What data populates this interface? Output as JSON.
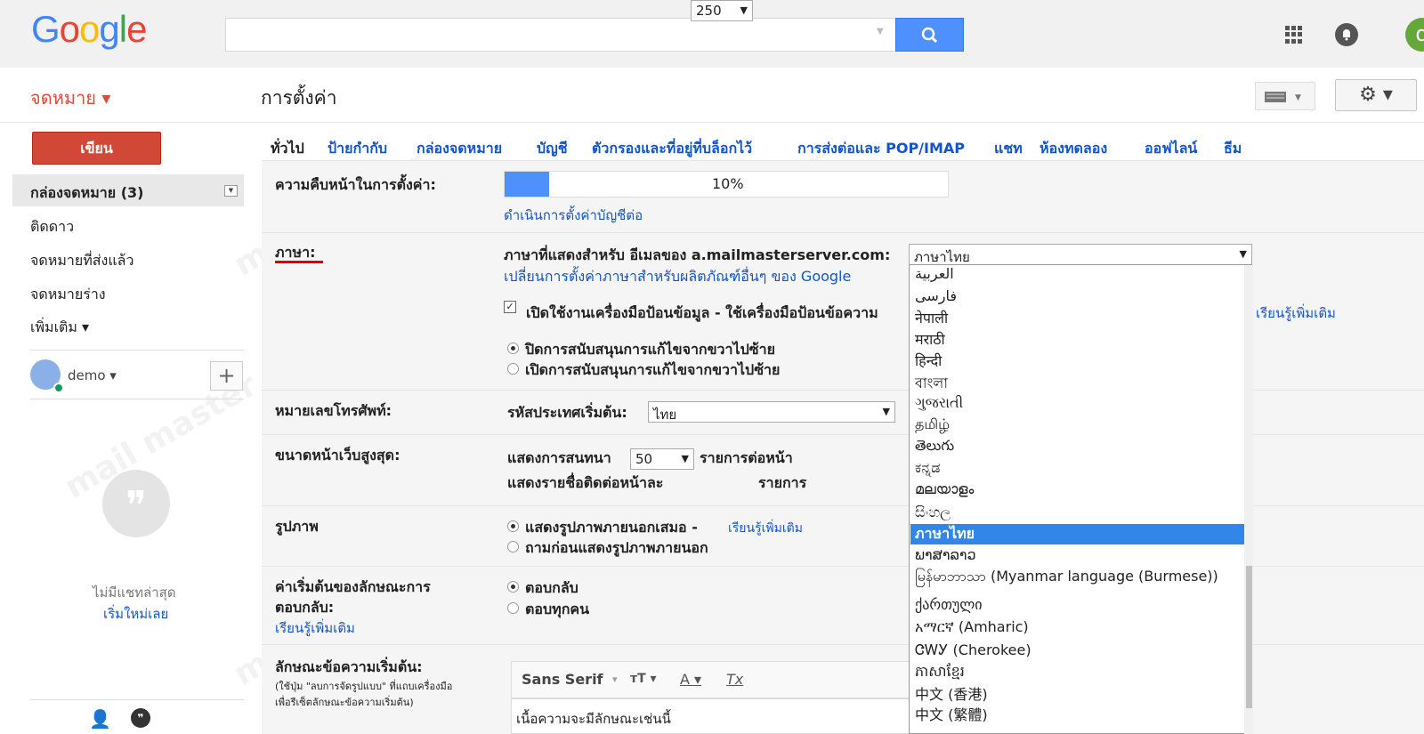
{
  "header": {
    "logo_letters": [
      {
        "ch": "G",
        "color": "#4285f4"
      },
      {
        "ch": "o",
        "color": "#ea4335"
      },
      {
        "ch": "o",
        "color": "#fbbc05"
      },
      {
        "ch": "g",
        "color": "#4285f4"
      },
      {
        "ch": "l",
        "color": "#34a853"
      },
      {
        "ch": "e",
        "color": "#ea4335"
      }
    ],
    "search_icon": "search-icon",
    "apps_icon": "apps-grid-icon",
    "notifications_icon": "notifications-icon",
    "avatar_letter": "d"
  },
  "subbar": {
    "mail_menu": "จดหมาย ▾",
    "page_title": "การตั้งค่า",
    "settings_icon": "⚙ ▾"
  },
  "sidebar": {
    "compose": "เขียน",
    "items": [
      {
        "label": "กล่องจดหมาย (3)"
      },
      {
        "label": "ติดดาว"
      },
      {
        "label": "จดหมายที่ส่งแล้ว"
      },
      {
        "label": "จดหมายร่าง"
      },
      {
        "label": "เพิ่มเติม ▾"
      }
    ],
    "user_name": "demo ▾",
    "add_chat": "+",
    "no_chats": "ไม่มีแชทล่าสุด",
    "start_new": "เริ่มใหม่เลย"
  },
  "tabs": [
    "ทั่วไป",
    "ป้ายกำกับ",
    "กล่องจดหมาย",
    "บัญชี",
    "ตัวกรองและที่อยู่ที่บล็อกไว้",
    "การส่งต่อและ POP/IMAP",
    "แชท",
    "ห้องทดลอง",
    "ออฟไลน์",
    "ธีม"
  ],
  "settings": {
    "progress": {
      "label": "ความคืบหน้าในการตั้งค่า:",
      "percent": 10,
      "percent_text": "10%",
      "continue_link": "ดำเนินการตั้งค่าบัญชีต่อ"
    },
    "language": {
      "label": "ภาษา:",
      "display_label": "ภาษาที่แสดงสำหรับ อีเมลของ a.mailmasterserver.com:",
      "selected": "ภาษาไทย",
      "change_link": "เปลี่ยนการตั้งค่าภาษาสำหรับผลิตภัณฑ์อื่นๆ ของ Google",
      "input_tools": "เปิดใช้งานเครื่องมือป้อนข้อมูล - ใช้เครื่องมือป้อนข้อความ",
      "learn_more": "เรียนรู้เพิ่มเติม",
      "rtl_off": "ปิดการสนับสนุนการแก้ไขจากขวาไปซ้าย",
      "rtl_on": "เปิดการสนับสนุนการแก้ไขจากขวาไปซ้าย",
      "options": [
        "العربية",
        "فارسی",
        "नेपाली",
        "मराठी",
        "हिन्दी",
        "বাংলা",
        "ગુજરાતી",
        "தமிழ்",
        "తెలుగు",
        "ಕನ್ನಡ",
        "മലയാളം",
        "සිංහල",
        "ภาษาไทย",
        "ພາສາລາວ",
        "မြန်မာဘာသာ (Myanmar language (Burmese))",
        "ქართული",
        "አማርኛ (Amharic)",
        "ᏣᎳᎩ (Cherokee)",
        "ភាសាខ្មែរ",
        "中文 (香港)",
        "中文 (繁體)"
      ]
    },
    "phone": {
      "label": "หมายเลขโทรศัพท์:",
      "country_label": "รหัสประเทศเริ่มต้น:",
      "country_value": "ไทย"
    },
    "page_size": {
      "label": "ขนาดหน้าเว็บสูงสุด:",
      "conv_prefix": "แสดงการสนทนา",
      "conv_value": "50",
      "conv_suffix": "รายการต่อหน้า",
      "contacts_prefix": "แสดงรายชื่อติดต่อหน้าละ",
      "contacts_value": "250",
      "contacts_suffix": "รายการ"
    },
    "images": {
      "label": "รูปภาพ",
      "always": "แสดงรูปภาพภายนอกเสมอ -",
      "learn_more": "เรียนรู้เพิ่มเติม",
      "ask": "ถามก่อนแสดงรูปภาพภายนอก"
    },
    "reply": {
      "label_line1": "ค่าเริ่มต้นของลักษณะการ",
      "label_line2": "ตอบกลับ:",
      "learn_more": "เรียนรู้เพิ่มเติม",
      "reply": "ตอบกลับ",
      "reply_all": "ตอบทุกคน"
    },
    "text_style": {
      "label": "ลักษณะข้อความเริ่มต้น:",
      "hint_line1": "(ใช้ปุ่ม \"ลบการจัดรูปแบบ\" ที่แถบเครื่องมือ",
      "hint_line2": "เพื่อรีเซ็ตลักษณะข้อความเริ่มต้น)",
      "font": "Sans Serif",
      "size_icon": "ᴛT ▾",
      "color_icon": "A ▾",
      "clear_icon": "Tx",
      "preview": "เนื้อความจะมีลักษณะเช่นนี้"
    }
  },
  "watermark": "mail master"
}
